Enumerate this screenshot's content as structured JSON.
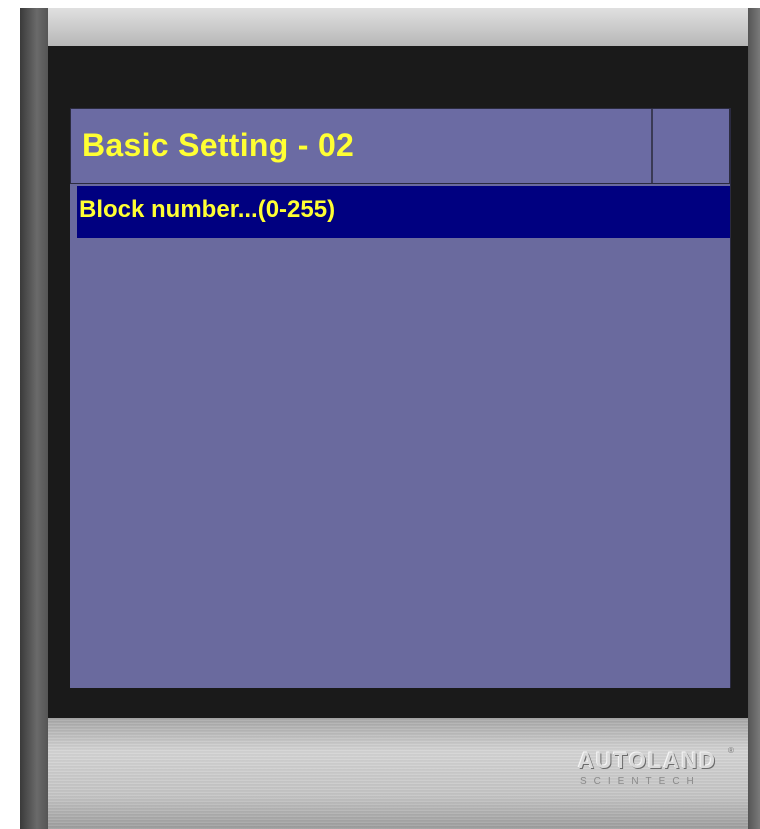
{
  "screen": {
    "title": "Basic Setting - 02",
    "list_items": [
      {
        "label": "Block number...(0-255)",
        "selected": true
      }
    ]
  },
  "brand": {
    "name": "AUTOLAND",
    "subtitle": "SCIENTECH",
    "reg_mark": "®"
  },
  "colors": {
    "screen_bg": "#6a6a9e",
    "title_text": "#ffff33",
    "selected_row_bg": "#000080",
    "bezel": "#1a1a1a"
  }
}
